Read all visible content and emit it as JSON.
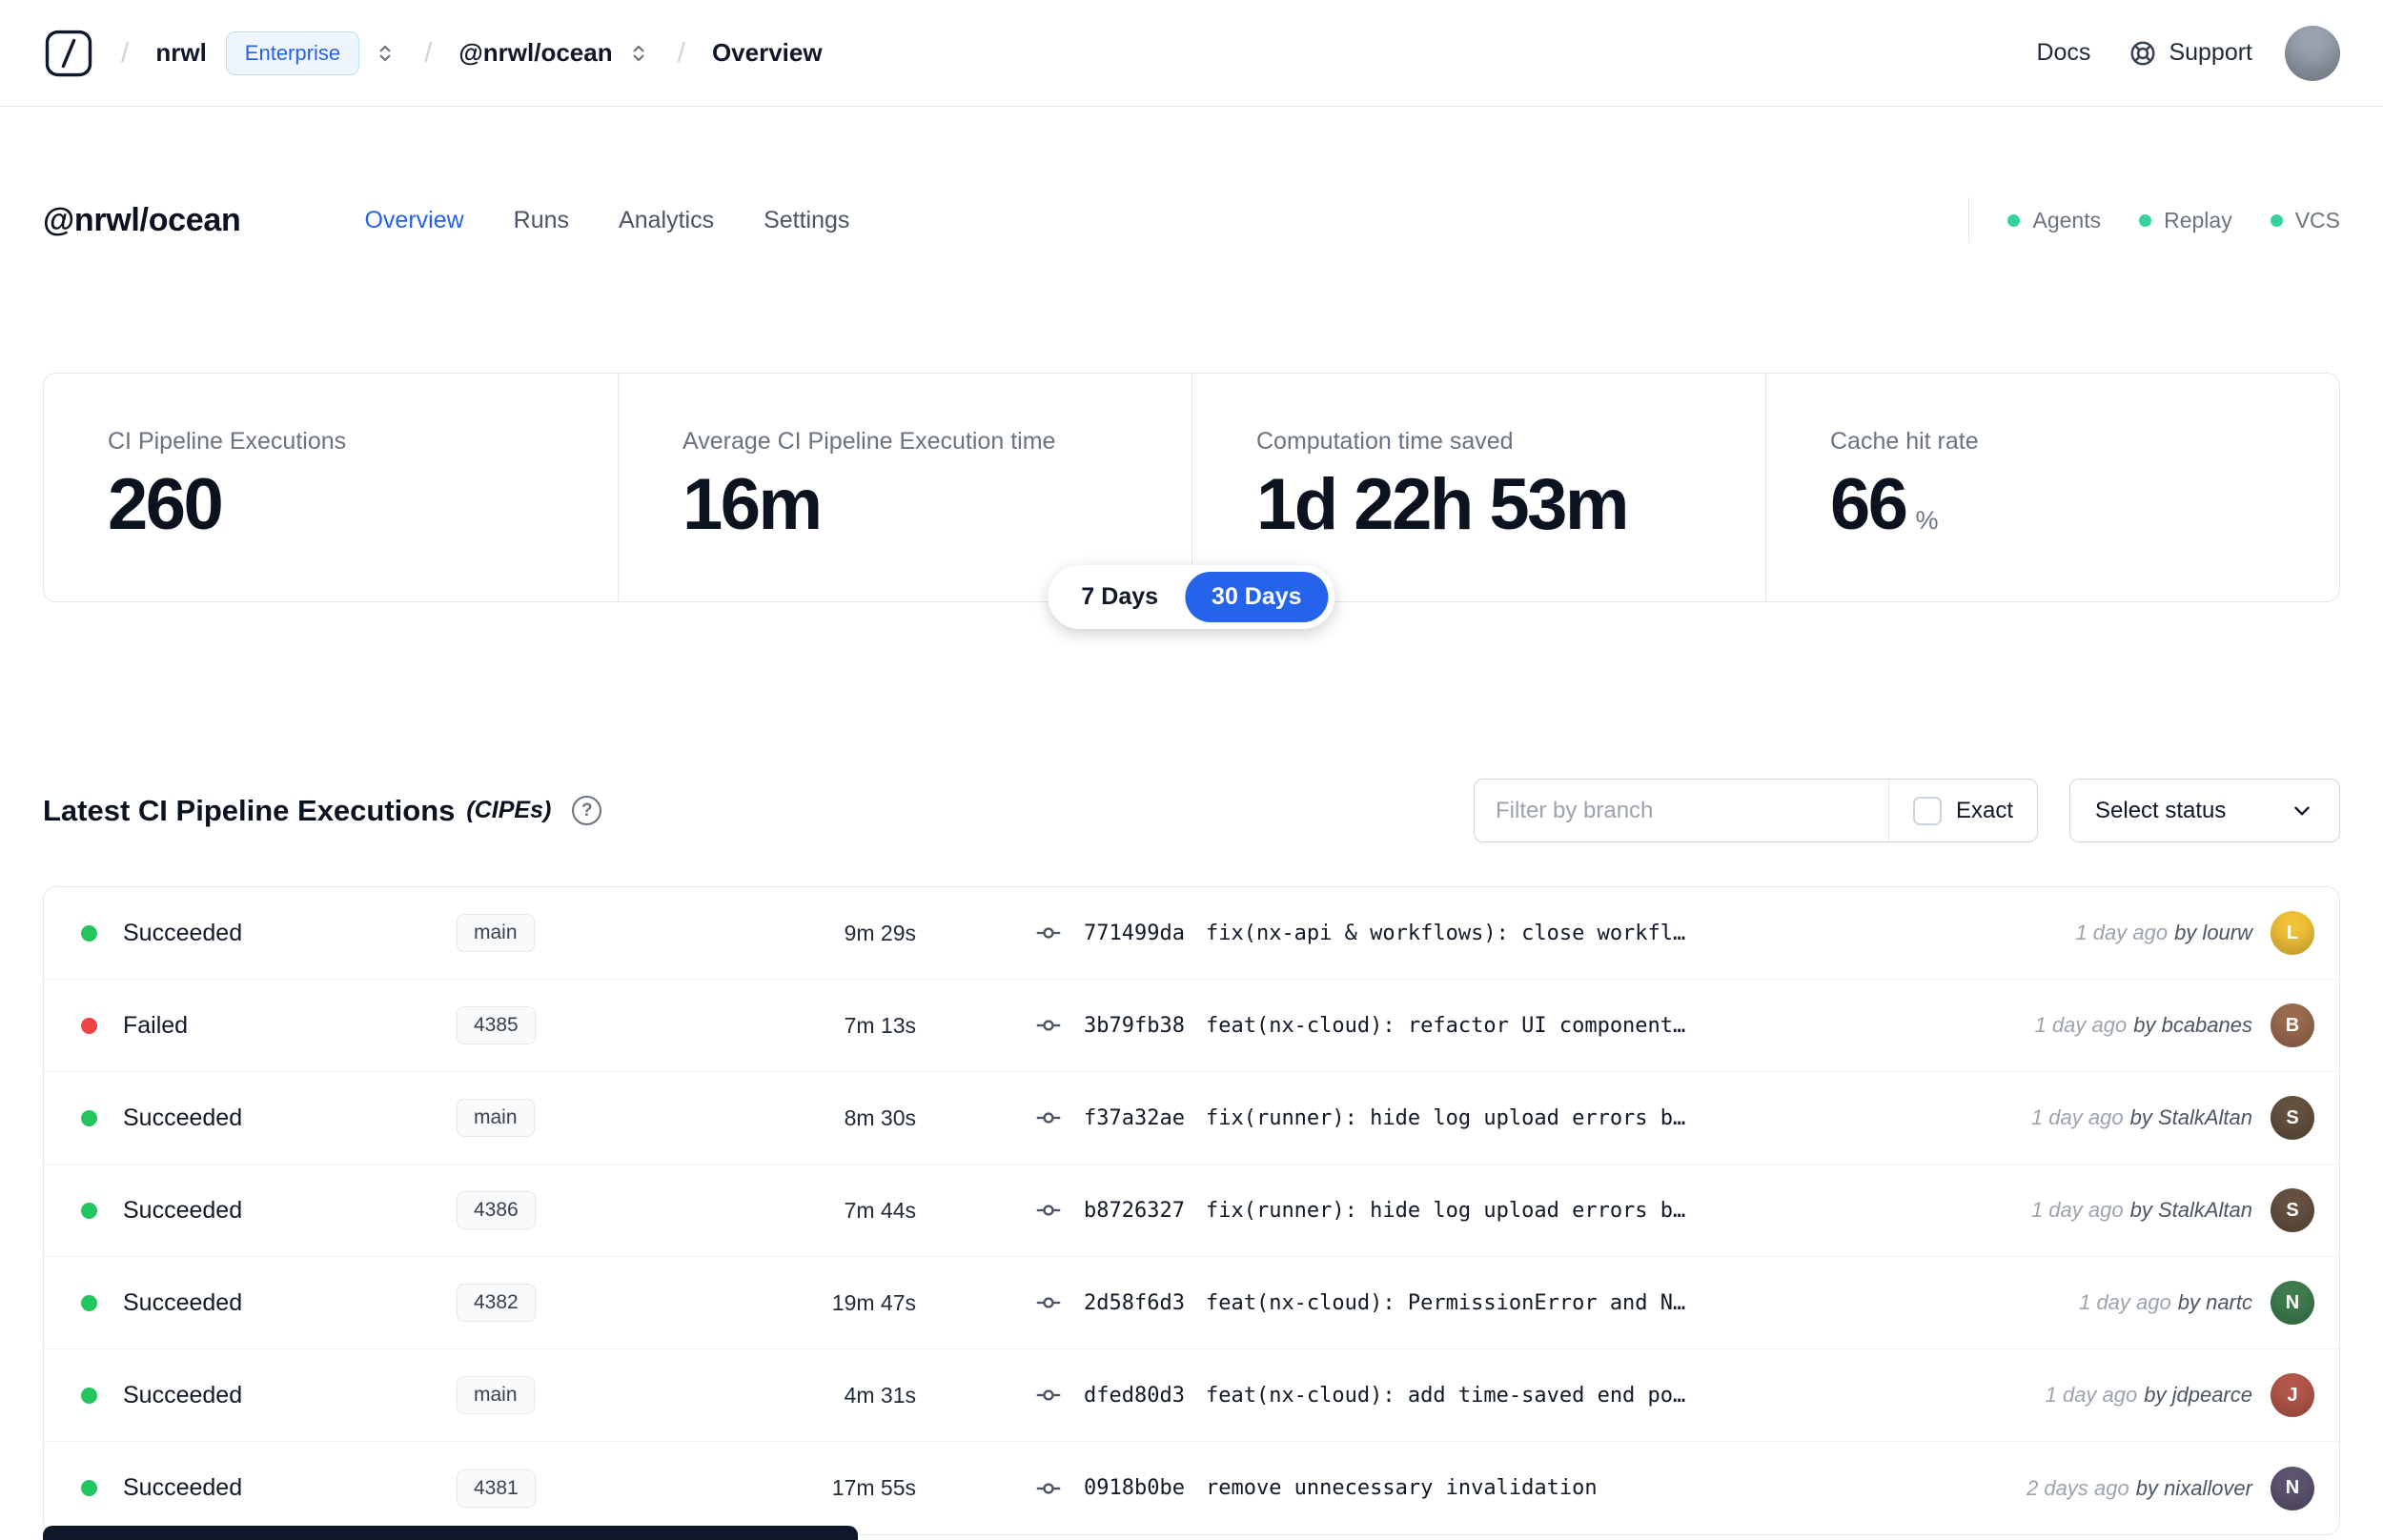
{
  "colors": {
    "accent": "#2563eb",
    "success": "#22c55e",
    "danger": "#ef4444",
    "indicator": "#34d399"
  },
  "navbar": {
    "separator": "/",
    "org": "nrwl",
    "org_badge": "Enterprise",
    "workspace": "@nrwl/ocean",
    "page": "Overview",
    "docs": "Docs",
    "support": "Support",
    "avatar_color": "#9aa4b2"
  },
  "header": {
    "title": "@nrwl/ocean",
    "tabs": [
      {
        "label": "Overview"
      },
      {
        "label": "Runs"
      },
      {
        "label": "Analytics"
      },
      {
        "label": "Settings"
      }
    ],
    "indicators": [
      {
        "label": "Agents"
      },
      {
        "label": "Replay"
      },
      {
        "label": "VCS"
      }
    ]
  },
  "stats": {
    "cards": [
      {
        "label": "CI Pipeline Executions",
        "value": "260"
      },
      {
        "label": "Average CI Pipeline Execution time",
        "value": "16m"
      },
      {
        "label": "Computation time saved",
        "value": "1d 22h 53m"
      },
      {
        "label": "Cache hit rate",
        "value": "66",
        "suffix": "%"
      }
    ],
    "range": {
      "options": [
        "7 Days",
        "30 Days"
      ],
      "selected": "30 Days"
    }
  },
  "cipes": {
    "title": "Latest CI Pipeline Executions",
    "subtitle": "(CIPEs)",
    "help_glyph": "?",
    "filter": {
      "placeholder": "Filter by branch",
      "exact_label": "Exact",
      "exact_checked": false
    },
    "status_select_label": "Select status",
    "rows": [
      {
        "status": "Succeeded",
        "dot_color": "#22c55e",
        "branch": "main",
        "duration": "9m 29s",
        "commit": "771499da",
        "message": "fix(nx-api & workflows): close workfl…",
        "time": "1 day ago",
        "author": "by lourw",
        "avatar_color": "#f2c238",
        "avatar_initial": "L"
      },
      {
        "status": "Failed",
        "dot_color": "#ef4444",
        "branch": "4385",
        "duration": "7m 13s",
        "commit": "3b79fb38",
        "message": "feat(nx-cloud): refactor UI component…",
        "time": "1 day ago",
        "author": "by bcabanes",
        "avatar_color": "#9a6b4f",
        "avatar_initial": "B"
      },
      {
        "status": "Succeeded",
        "dot_color": "#22c55e",
        "branch": "main",
        "duration": "8m 30s",
        "commit": "f37a32ae",
        "message": "fix(runner): hide log upload errors b…",
        "time": "1 day ago",
        "author": "by StalkAltan",
        "avatar_color": "#64513f",
        "avatar_initial": "S"
      },
      {
        "status": "Succeeded",
        "dot_color": "#22c55e",
        "branch": "4386",
        "duration": "7m 44s",
        "commit": "b8726327",
        "message": "fix(runner): hide log upload errors b…",
        "time": "1 day ago",
        "author": "by StalkAltan",
        "avatar_color": "#64513f",
        "avatar_initial": "S"
      },
      {
        "status": "Succeeded",
        "dot_color": "#22c55e",
        "branch": "4382",
        "duration": "19m 47s",
        "commit": "2d58f6d3",
        "message": "feat(nx-cloud): PermissionError and N…",
        "time": "1 day ago",
        "author": "by nartc",
        "avatar_color": "#3f7d4e",
        "avatar_initial": "N"
      },
      {
        "status": "Succeeded",
        "dot_color": "#22c55e",
        "branch": "main",
        "duration": "4m 31s",
        "commit": "dfed80d3",
        "message": "feat(nx-cloud): add time-saved end po…",
        "time": "1 day ago",
        "author": "by jdpearce",
        "avatar_color": "#b4574a",
        "avatar_initial": "J"
      },
      {
        "status": "Succeeded",
        "dot_color": "#22c55e",
        "branch": "4381",
        "duration": "17m 55s",
        "commit": "0918b0be",
        "message": "remove unnecessary invalidation",
        "time": "2 days ago",
        "author": "by nixallover",
        "avatar_color": "#5d5470",
        "avatar_initial": "N"
      }
    ]
  },
  "icons": {
    "logo": "nx-cloud-logo",
    "switcher": "chevron-up-down",
    "support": "lifebuoy",
    "help": "question-circle",
    "commit": "git-commit",
    "select_chevron": "chevron-down"
  }
}
